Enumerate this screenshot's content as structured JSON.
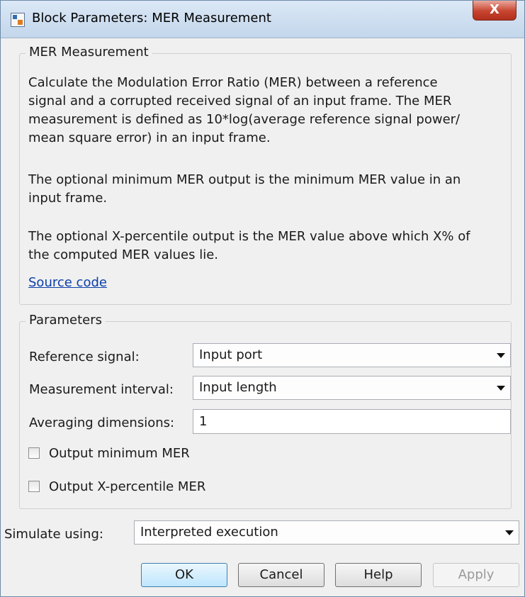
{
  "window": {
    "title": "Block Parameters: MER Measurement",
    "close_label": "X"
  },
  "description_group": {
    "title": "MER Measurement",
    "paragraphs": [
      [
        "Calculate the Modulation Error Ratio (MER) between a reference",
        "signal and a corrupted received signal of an input frame. The MER",
        "measurement is defined as 10*log(average reference signal power/",
        "mean square error) in an input frame."
      ],
      [
        "The optional minimum MER output is the minimum MER value in an",
        "input frame."
      ],
      [
        "The optional X-percentile output is the MER value above which X% of",
        "the computed MER values lie."
      ]
    ],
    "link": "Source code"
  },
  "parameters_group": {
    "title": "Parameters",
    "reference_signal": {
      "label": "Reference signal:",
      "value": "Input port"
    },
    "measurement_interval": {
      "label": "Measurement interval:",
      "value": "Input length"
    },
    "averaging_dimensions": {
      "label": "Averaging dimensions:",
      "value": "1"
    },
    "output_min_mer": {
      "label": "Output minimum MER",
      "checked": false
    },
    "output_xpct_mer": {
      "label": "Output X-percentile MER",
      "checked": false
    }
  },
  "simulate": {
    "label": "Simulate using:",
    "value": "Interpreted execution"
  },
  "buttons": {
    "ok": "OK",
    "cancel": "Cancel",
    "help": "Help",
    "apply": "Apply"
  }
}
